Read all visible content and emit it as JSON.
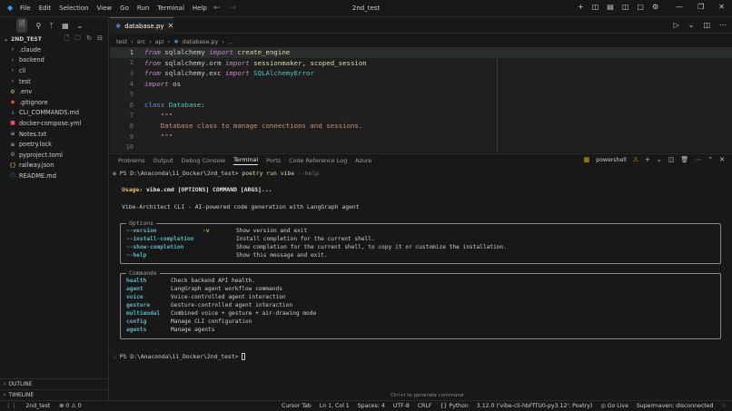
{
  "titlebar": {
    "menus": [
      "File",
      "Edit",
      "Selection",
      "View",
      "Go",
      "Run",
      "Terminal",
      "Help"
    ],
    "title": "2nd_test"
  },
  "sidebar": {
    "root": "2ND_TEST",
    "items": [
      {
        "label": ".claude",
        "type": "folder"
      },
      {
        "label": "backend",
        "type": "folder"
      },
      {
        "label": "cli",
        "type": "folder"
      },
      {
        "label": "test",
        "type": "folder"
      },
      {
        "label": ".env",
        "type": "env"
      },
      {
        "label": ".gitignore",
        "type": "git"
      },
      {
        "label": "CLI_COMMANDS.md",
        "type": "md"
      },
      {
        "label": "docker-compose.yml",
        "type": "docker"
      },
      {
        "label": "Notes.txt",
        "type": "txt"
      },
      {
        "label": "poetry.lock",
        "type": "lock"
      },
      {
        "label": "pyproject.toml",
        "type": "toml"
      },
      {
        "label": "railway.json",
        "type": "json"
      },
      {
        "label": "README.md",
        "type": "info"
      }
    ],
    "outline": "OUTLINE",
    "timeline": "TIMELINE"
  },
  "editor": {
    "tab_label": "database.py",
    "breadcrumb": [
      "test",
      "src",
      "api",
      "database.py",
      "..."
    ],
    "lines": [
      {
        "n": "1"
      },
      {
        "n": "2"
      },
      {
        "n": "3"
      },
      {
        "n": "4"
      },
      {
        "n": "5"
      },
      {
        "n": "6"
      },
      {
        "n": "7"
      },
      {
        "n": "8"
      },
      {
        "n": "9"
      },
      {
        "n": "10"
      }
    ],
    "code": {
      "l1_from": "from",
      "l1_mod": " sqlalchemy ",
      "l1_import": "import",
      "l1_name": " create_engine",
      "l2_from": "from",
      "l2_mod": " sqlalchemy.orm ",
      "l2_import": "import",
      "l2_name": " sessionmaker, scoped_session",
      "l3_from": "from",
      "l3_mod": " sqlalchemy.exc ",
      "l3_import": "import",
      "l3_name": " SQLAlchemyError",
      "l4_import": "import",
      "l4_name": " os",
      "l6_class": "class",
      "l6_name": " Database",
      "l6_colon": ":",
      "l7_doc": "    \"\"\"",
      "l8_doc": "    Database class to manage connections and sessions.",
      "l9_doc": "    \"\"\""
    }
  },
  "panel": {
    "tabs": [
      "Problems",
      "Output",
      "Debug Console",
      "Terminal",
      "Ports",
      "Code Reference Log",
      "Azure"
    ],
    "active_tab": "Terminal",
    "shell_label": "powershell"
  },
  "terminal": {
    "prompt1": "PS D:\\Anaconda\\11_Docker\\2nd_test> ",
    "cmd1": "poetry run vibe",
    "cmd1_flag": " --help",
    "usage_label": "Usage: ",
    "usage_text": "vibe.cmd [OPTIONS] COMMAND [ARGS]...",
    "description": "Vibe-Architect CLI - AI-powered code generation with LangGraph agent",
    "options_title": "Options",
    "options": [
      {
        "flag": "--version",
        "short": "-v",
        "desc": "Show version and exit"
      },
      {
        "flag": "--install-completion",
        "short": "",
        "desc": "Install completion for the current shell."
      },
      {
        "flag": "--show-completion",
        "short": "",
        "desc": "Show completion for the current shell, to copy it or customize the installation."
      },
      {
        "flag": "--help",
        "short": "",
        "desc": "Show this message and exit."
      }
    ],
    "commands_title": "Commands",
    "commands": [
      {
        "name": "health",
        "desc": "Check backend API health."
      },
      {
        "name": "agent",
        "desc": "LangGraph agent workflow commands"
      },
      {
        "name": "voice",
        "desc": "Voice-controlled agent interaction"
      },
      {
        "name": "gesture",
        "desc": "Gesture-controlled agent interaction"
      },
      {
        "name": "multimodal",
        "desc": "Combined voice + gesture + air-drawing mode"
      },
      {
        "name": "config",
        "desc": "Manage CLI configuration"
      },
      {
        "name": "agents",
        "desc": "Manage agents"
      }
    ],
    "prompt2": "PS D:\\Anaconda\\11_Docker\\2nd_test> "
  },
  "hint": "Ctrl+I to generate command",
  "statusbar": {
    "project": "2nd_test",
    "problems": "0 ⚠ 0",
    "cursor_tab": "Cursor Tab",
    "position": "Ln 1, Col 1",
    "spaces": "Spaces: 4",
    "encoding": "UTF-8",
    "eol": "CRLF",
    "language": "Python",
    "interpreter": "3.12.0 ('vibe-cli-hbFfTU0-py3.12': Poetry)",
    "golive": "Go Live",
    "supermaven": "Supermaven: disconnected"
  },
  "colors": {
    "accent": "#0078d4",
    "usage": "#e5c07b",
    "option": "#56b6c2"
  }
}
